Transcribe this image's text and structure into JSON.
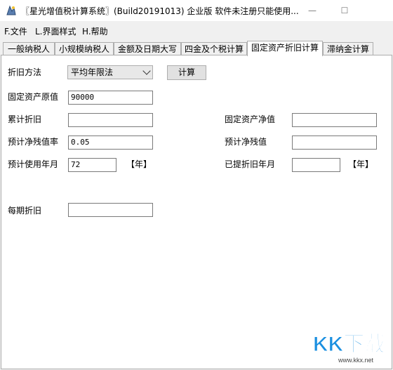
{
  "window": {
    "title": "〖星光增值税计算系统〗(Build20191013) 企业版 软件未注册只能使用...",
    "minimize_glyph": "—",
    "maximize_glyph": "☐"
  },
  "menu": [
    "F.文件",
    "L.界面样式",
    "H.帮助"
  ],
  "tabs": [
    "一般纳税人",
    "小规模纳税人",
    "金额及日期大写",
    "四金及个税计算",
    "固定资产折旧计算",
    "滞纳金计算"
  ],
  "active_tab": "固定资产折旧计算",
  "form": {
    "method_label": "折旧方法",
    "method_value": "平均年限法",
    "calc_button": "计算",
    "original_value_label": "固定资产原值",
    "original_value": "90000",
    "accum_depr_label": "累计折旧",
    "accum_depr_value": "",
    "net_value_label": "固定资产净值",
    "net_value": "",
    "residual_rate_label": "预计净残值率",
    "residual_rate_value": "0.05",
    "residual_value_label": "预计净残值",
    "residual_value": "",
    "useful_life_label": "预计使用年月",
    "useful_life_value": "72",
    "useful_life_unit": "【年】",
    "depr_period_label": "已提折旧年月",
    "depr_period_value": "",
    "depr_period_unit": "【年】",
    "per_period_label": "每期折旧",
    "per_period_value": ""
  },
  "watermark": {
    "logo_text": "KK下载",
    "url": "www.kkx.net",
    "brand_color": "#1a8fe0"
  }
}
